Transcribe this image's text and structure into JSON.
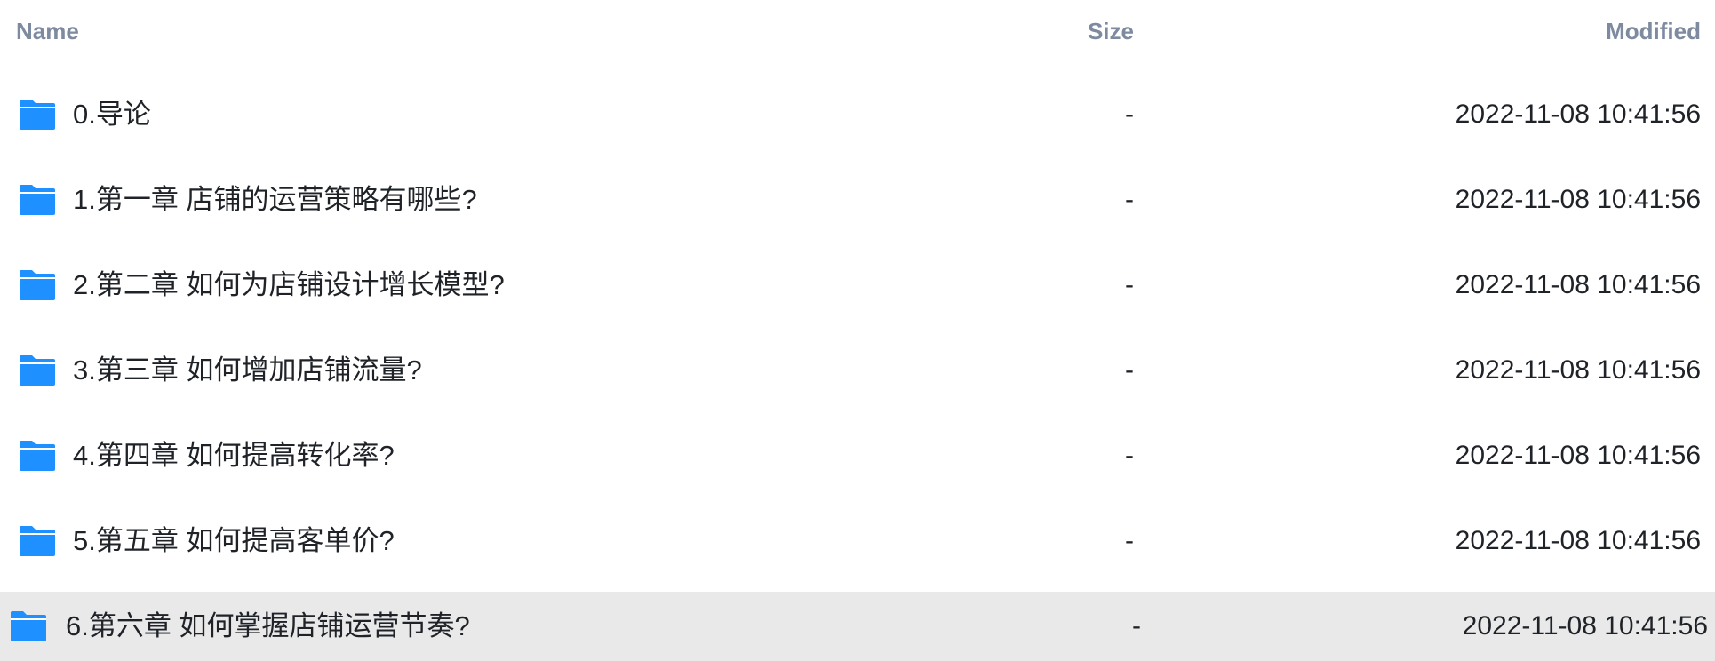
{
  "columns": {
    "name": "Name",
    "size": "Size",
    "modified": "Modified"
  },
  "colors": {
    "folder": "#1e90ff",
    "header_text": "#7d8aa0",
    "selected_row_bg": "#e9e9ea"
  },
  "rows": [
    {
      "icon": "folder-icon",
      "name": "0.导论",
      "size": "-",
      "modified": "2022-11-08 10:41:56"
    },
    {
      "icon": "folder-icon",
      "name": "1.第一章 店铺的运营策略有哪些?",
      "size": "-",
      "modified": "2022-11-08 10:41:56"
    },
    {
      "icon": "folder-icon",
      "name": "2.第二章 如何为店铺设计增长模型?",
      "size": "-",
      "modified": "2022-11-08 10:41:56"
    },
    {
      "icon": "folder-icon",
      "name": "3.第三章 如何增加店铺流量?",
      "size": "-",
      "modified": "2022-11-08 10:41:56"
    },
    {
      "icon": "folder-icon",
      "name": "4.第四章 如何提高转化率?",
      "size": "-",
      "modified": "2022-11-08 10:41:56"
    },
    {
      "icon": "folder-icon",
      "name": "5.第五章 如何提高客单价?",
      "size": "-",
      "modified": "2022-11-08 10:41:56"
    },
    {
      "icon": "folder-icon",
      "name": "6.第六章 如何掌握店铺运营节奏?",
      "size": "-",
      "modified": "2022-11-08 10:41:56",
      "selected": true
    }
  ]
}
